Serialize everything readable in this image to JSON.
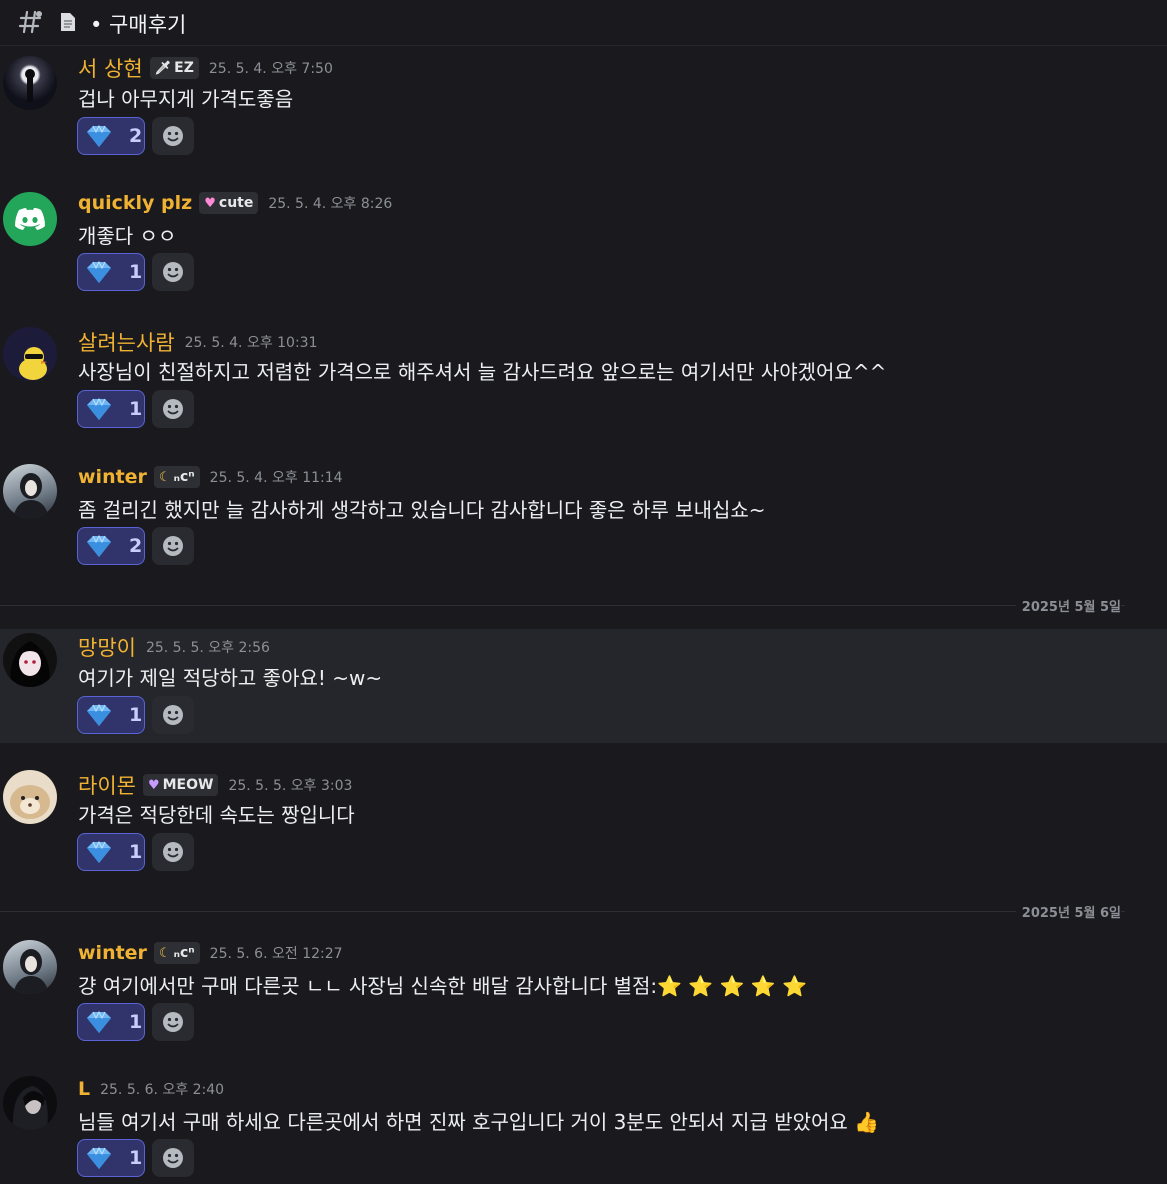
{
  "header": {
    "title": "• 구매후기",
    "icon": "threads-icon"
  },
  "messages": [
    {
      "user": "서 상현",
      "tag": "EZ",
      "tag_icon": "sword",
      "time": "25. 5. 4. 오후 7:50",
      "text": "겁나 아무지게 가격도좋음",
      "reaction_count": "2"
    },
    {
      "user": "quickly plz",
      "tag": "cute",
      "tag_icon": "pink-heart",
      "time": "25. 5. 4. 오후 8:26",
      "text": "개좋다 ㅇㅇ",
      "reaction_count": "1"
    },
    {
      "user": "살려는사람",
      "tag": "",
      "time": "25. 5. 4. 오후 10:31",
      "text": "사장님이 친절하지고 저렴한 가격으로 해주셔서 늘 감사드려요 앞으로는 여기서만 사야겠어요^^",
      "reaction_count": "1"
    },
    {
      "user": "winter",
      "tag": "ₙcⁿ",
      "tag_icon": "moon",
      "time": "25. 5. 4. 오후 11:14",
      "text": "좀 걸리긴 했지만 늘 감사하게 생각하고 있습니다 감사합니다 좋은 하루 보내십쇼~",
      "reaction_count": "2"
    },
    {
      "user": "망망이",
      "tag": "",
      "time": "25. 5. 5. 오후 2:56",
      "text": "여기가 제일 적당하고 좋아요!  ~w~",
      "reaction_count": "1"
    },
    {
      "user": "라이몬",
      "tag": "MEOW",
      "tag_icon": "purple-heart",
      "time": "25. 5. 5. 오후 3:03",
      "text": "가격은 적당한데 속도는 짱입니다",
      "reaction_count": "1"
    },
    {
      "user": "winter",
      "tag": "ₙcⁿ",
      "tag_icon": "moon",
      "time": "25. 5. 6. 오전 12:27",
      "text": "걍 여기에서만 구매 다른곳 ㄴㄴ 사장님 신속한 배달 감사합니다 별점:",
      "stars": "⭐ ⭐ ⭐ ⭐ ⭐",
      "reaction_count": "1"
    },
    {
      "user": "L",
      "tag": "",
      "time": "25. 5. 6. 오후 2:40",
      "text": "님들 여기서 구매 하세요 다른곳에서 하면 진짜 호구입니다 거이 3분도 안되서 지급 받았어요",
      "emoji": "👍",
      "reaction_count": "1"
    }
  ],
  "dividers": [
    "2025년 5월 5일",
    "2025년 5월 6일"
  ],
  "colors": {
    "username": "#f0b232",
    "reaction_bg": "#30346a",
    "reaction_border": "#5a63d6",
    "background": "#1a1a1e"
  }
}
